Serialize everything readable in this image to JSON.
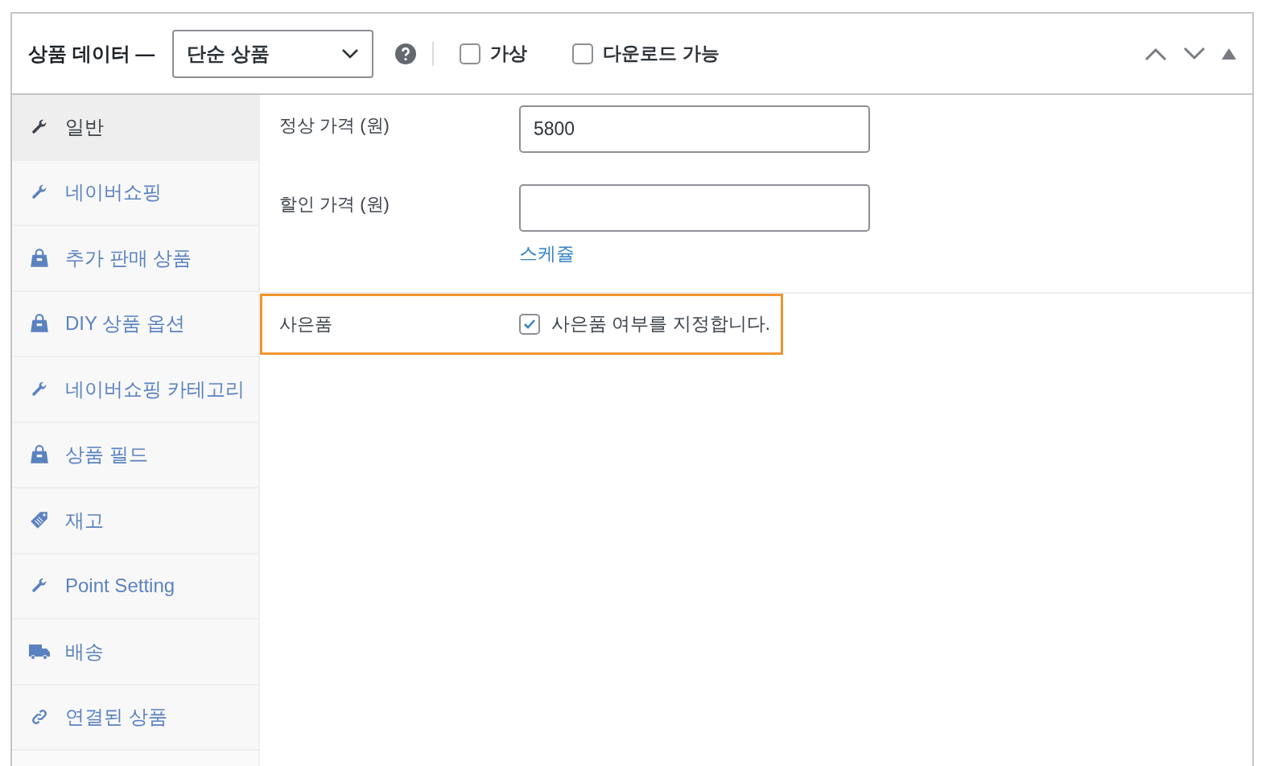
{
  "header": {
    "title": "상품 데이터 —",
    "product_type": "단순 상품",
    "options": [
      {
        "label": "가상",
        "checked": false
      },
      {
        "label": "다운로드 가능",
        "checked": false
      }
    ]
  },
  "sidebar": {
    "items": [
      {
        "label": "일반",
        "kind": "wrench",
        "selected": true
      },
      {
        "label": "네이버쇼핑",
        "kind": "wrench",
        "selected": false
      },
      {
        "label": "추가 판매 상품",
        "kind": "bag",
        "selected": false
      },
      {
        "label": "DIY 상품 옵션",
        "kind": "bag",
        "selected": false
      },
      {
        "label": "네이버쇼핑 카테고리",
        "kind": "wrench",
        "selected": false
      },
      {
        "label": "상품 필드",
        "kind": "bag",
        "selected": false
      },
      {
        "label": "재고",
        "kind": "tag",
        "selected": false
      },
      {
        "label": "Point Setting",
        "kind": "wrench",
        "selected": false
      },
      {
        "label": "배송",
        "kind": "truck",
        "selected": false
      },
      {
        "label": "연결된 상품",
        "kind": "link",
        "selected": false
      }
    ]
  },
  "pricing": {
    "fields": [
      {
        "label": "정상 가격 (원)",
        "value": "5800"
      },
      {
        "label": "할인 가격 (원)"
      }
    ],
    "schedule_link": "스케쥴"
  },
  "gift": {
    "label": "사은품",
    "checked": true,
    "description": "사은품 여부를 지정합니다.",
    "highlighted": true
  }
}
